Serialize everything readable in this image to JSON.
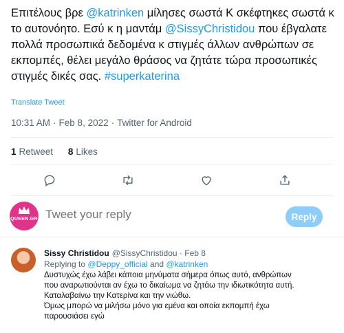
{
  "tweet": {
    "text_parts": [
      "Επιτέλους βρε ",
      "@katrinken",
      " μίλησες σωστά Κ σκέφτηκες σωστά κ το αυτονόητο. Εσύ κ η μαντάμ ",
      "@SissyChristidou",
      " που έβγαλατε πολλά προσωπικά δεδομένα κ στιγμές άλλων ανθρώπων σε εκπομπές, θέλει μεγάλο θράσος να ζητάτε τώρα προσωπικές στιγμές δικές σας. ",
      "#superkaterina"
    ],
    "translate_label": "Translate Tweet",
    "time": "10:31 AM",
    "date": "Feb 8, 2022",
    "client": "Twitter for Android",
    "retweets_count": "1",
    "retweets_label": "Retweet",
    "likes_count": "8",
    "likes_label": "Likes"
  },
  "actions": {
    "icons": [
      "reply-icon",
      "retweet-icon",
      "like-icon",
      "share-icon"
    ]
  },
  "reply_box": {
    "avatar_label": "QUEEN.GR",
    "placeholder": "Tweet your reply",
    "button_label": "Reply"
  },
  "reply": {
    "name": "Sissy Christidou",
    "handle": "@SissyChristidou",
    "date": "Feb 8",
    "replying_prefix": "Replying to",
    "replying_user1": "@Deppy_official",
    "replying_and": "and",
    "replying_user2": "@katrinken",
    "body_lines": [
      "Δυστυχώς έχω λάβει κάποια μηνύματα σήμερα όπως αυτό, ανθρώπων",
      "που αναρωτιούνται αν έχω το δικαίωμα να ζητάω την ιδιωτικότητα αυτή.",
      "Καταλαβαίνω την Κατερίνα και την νιώθω.",
      "Όμως μπορώ να μιλήσω μόνο για εμένα και οποία εκπομπή έχω",
      "παρουσιάσει εγώ"
    ]
  },
  "colors": {
    "accent": "#1d9bf0",
    "muted": "#536471",
    "reply_button_disabled": "#8ecdf8",
    "queen_avatar": "#e0338a"
  }
}
